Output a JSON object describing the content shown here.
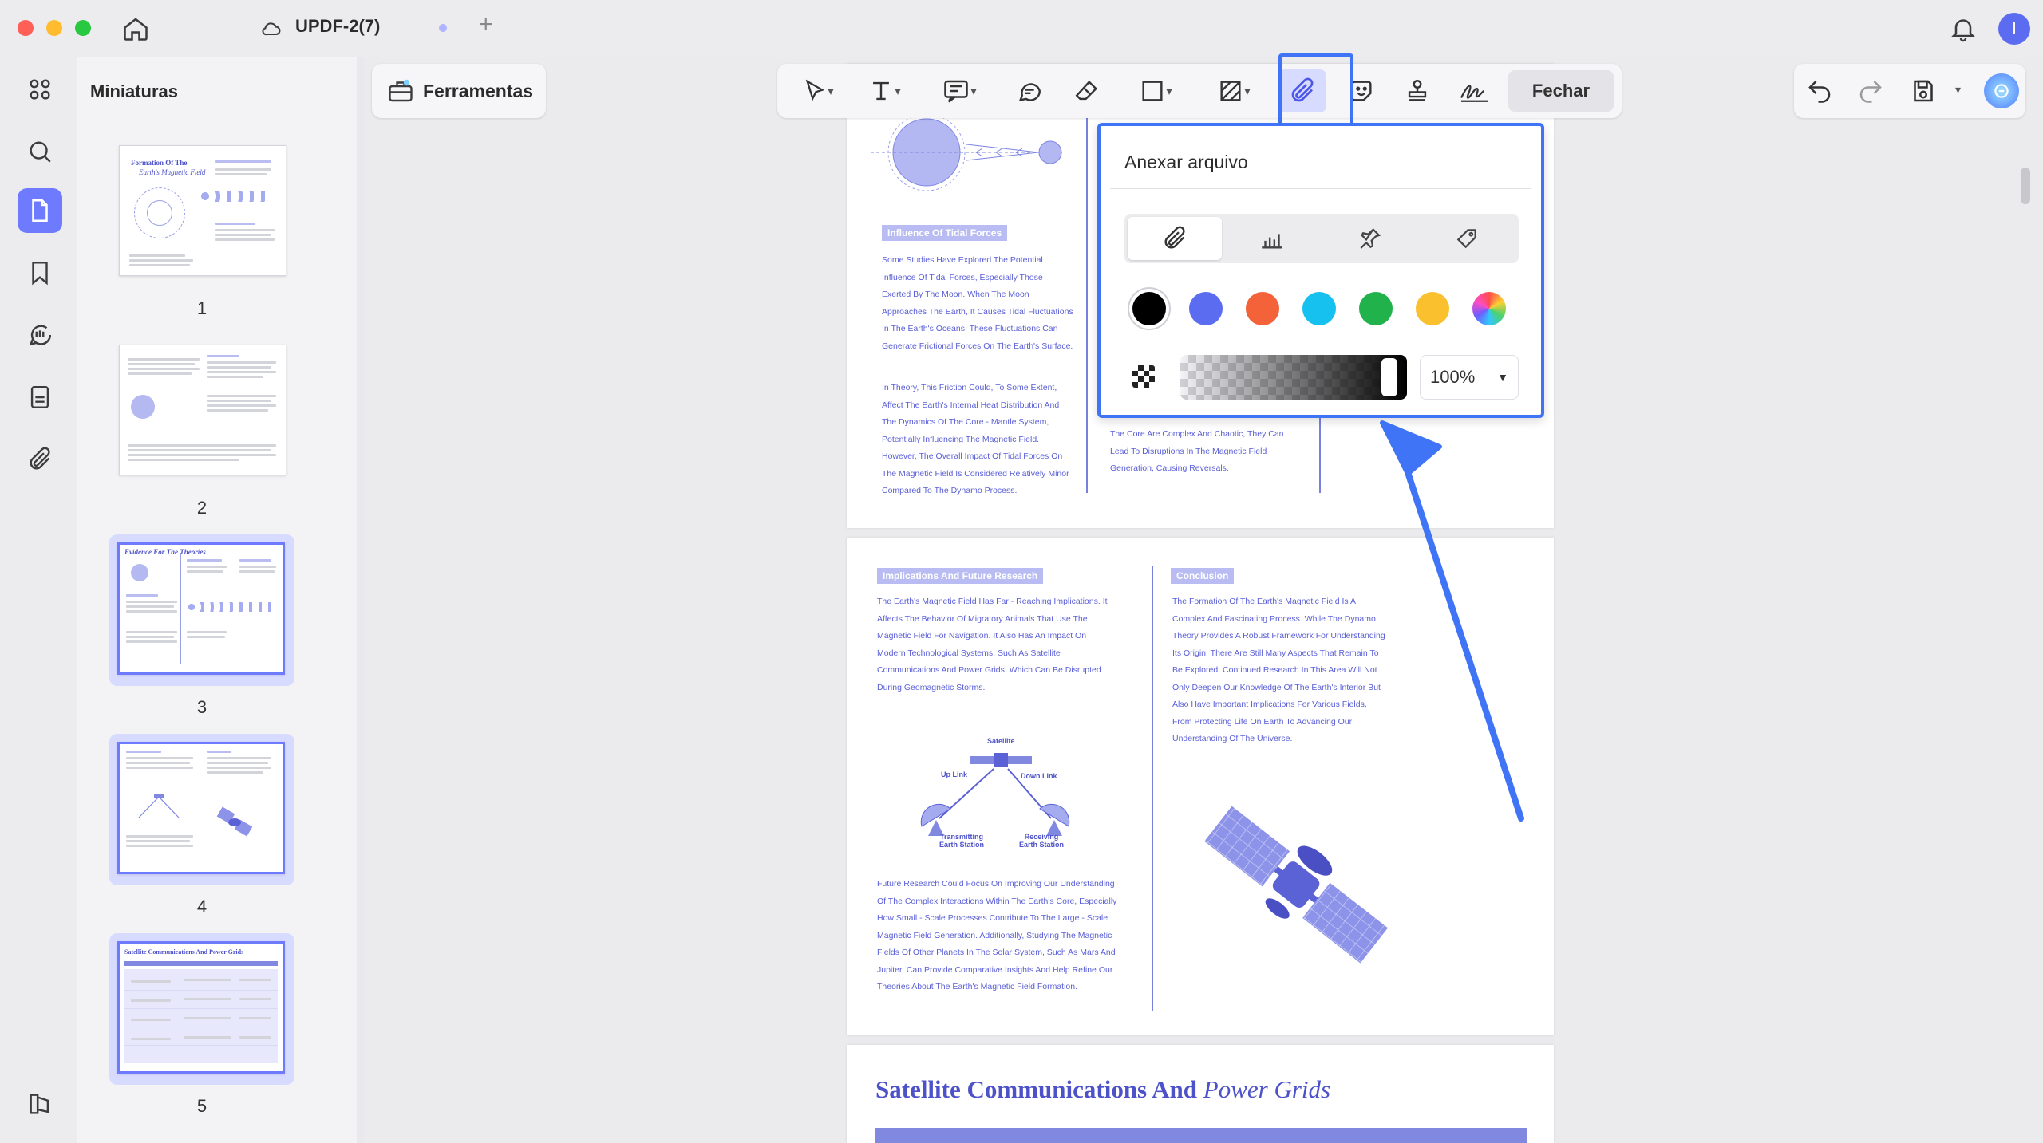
{
  "window": {
    "tab_title": "UPDF-2(7)",
    "add_tab": "+",
    "user_initial": "I",
    "colors": {
      "accent": "#6f7bff",
      "highlight": "#3f74f6"
    }
  },
  "sidebar": {
    "icons": [
      "thumbnails-grid-icon",
      "search-icon",
      "pages-icon",
      "bookmark-icon",
      "comments-icon",
      "forms-icon",
      "attachments-icon",
      "layers-icon"
    ]
  },
  "thumbnails": {
    "title": "Miniaturas",
    "pages": [
      {
        "number": "1",
        "heading": "Formation Of The",
        "heading2": "Earth's Magnetic Field"
      },
      {
        "number": "2"
      },
      {
        "number": "3",
        "heading": "Evidence For The Theories"
      },
      {
        "number": "4"
      },
      {
        "number": "5",
        "heading": "Satellite Communications And Power Grids"
      }
    ]
  },
  "toolbar": {
    "tools_label": "Ferramentas",
    "close_label": "Fechar",
    "items": [
      "select-tool",
      "text-tool",
      "text-callout-tool",
      "comment-tool",
      "eraser-tool",
      "shape-tool",
      "area-tool",
      "attach-file-tool",
      "sticker-tool",
      "stamp-tool",
      "signature-tool"
    ]
  },
  "popup": {
    "title": "Anexar arquivo",
    "icon_options": [
      "paperclip-icon",
      "graph-icon",
      "pushpin-icon",
      "tag-icon"
    ],
    "selected_icon": "paperclip-icon",
    "colors": [
      "#000000",
      "#5b6cf0",
      "#f4623a",
      "#17c1ef",
      "#22b24c",
      "#fbc02d",
      "rainbow"
    ],
    "selected_color": "#000000",
    "opacity": "100%",
    "opacity_fraction": 1.0
  },
  "document": {
    "page_a": {
      "section_title": "Influence Of Tidal Forces",
      "para1": "Some Studies Have Explored The Potential Influence Of Tidal Forces, Especially Those Exerted By The Moon. When The Moon Approaches The Earth, It Causes Tidal Fluctuations In The Earth's Oceans. These Fluctuations Can Generate Frictional Forces On The Earth's Surface.",
      "para2": "In Theory, This Friction Could, To Some Extent, Affect The Earth's Internal Heat Distribution And The Dynamics Of The Core - Mantle System, Potentially Influencing The Magnetic Field. However, The Overall Impact Of Tidal Forces On The Magnetic Field Is Considered Relatively Minor Compared To The Dynamo Process.",
      "right_text": "The Core Are Complex And Chaotic, They Can Lead To Disruptions In The Magnetic Field Generation, Causing Reversals."
    },
    "page_b": {
      "section1": "Implications And Future Research",
      "para1": "The Earth's Magnetic Field Has Far - Reaching Implications. It Affects The Behavior Of Migratory Animals That Use The Magnetic Field For Navigation. It Also Has An Impact On Modern Technological Systems, Such As Satellite Communications And Power Grids, Which Can Be Disrupted During Geomagnetic Storms.",
      "section2": "Conclusion",
      "para2": "The Formation Of The Earth's Magnetic Field Is A Complex And Fascinating Process. While The Dynamo Theory Provides A Robust Framework For Understanding Its Origin, There Are Still Many Aspects That Remain To Be Explored. Continued Research In This Area Will Not Only Deepen Our Knowledge Of The Earth's Interior But Also Have Important Implications For Various Fields, From Protecting Life On Earth To Advancing Our Understanding Of The Universe.",
      "diagram": {
        "satellite": "Satellite",
        "up_link": "Up Link",
        "down_link": "Down Link",
        "transmitting": "Transmitting",
        "transmitting2": "Earth Station",
        "receiving": "Receiving",
        "receiving2": "Earth Station"
      },
      "para3": "Future Research Could Focus On Improving Our Understanding Of The Complex Interactions Within The Earth's Core, Especially How Small - Scale Processes Contribute To The Large - Scale Magnetic Field Generation. Additionally, Studying The Magnetic Fields Of Other Planets In The Solar System, Such As Mars And Jupiter, Can Provide Comparative Insights And Help Refine Our Theories About The Earth's Magnetic Field Formation."
    },
    "page_c": {
      "title_main": "Satellite Communications And ",
      "title_italic": "Power Grids"
    }
  }
}
